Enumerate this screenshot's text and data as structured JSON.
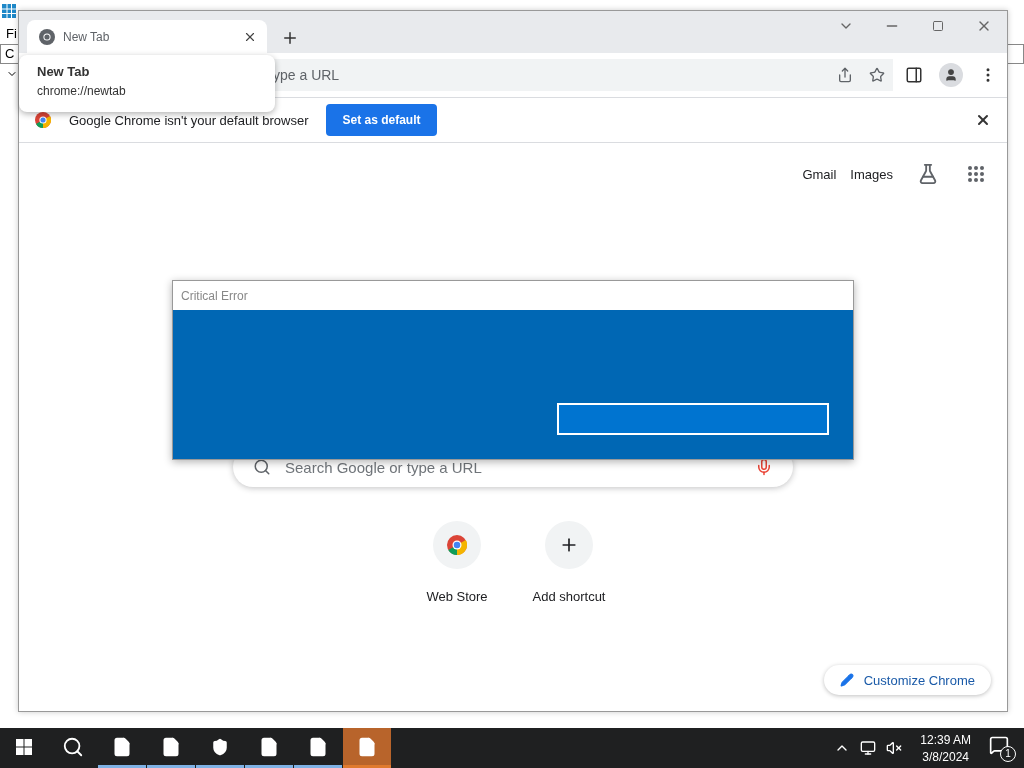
{
  "background_window": {
    "menu_fragment": "Fi",
    "field_fragment": "C"
  },
  "browser": {
    "tabs": [
      {
        "title": "New Tab",
        "selected": true
      }
    ],
    "tab_tooltip": {
      "title": "New Tab",
      "url": "chrome://newtab"
    },
    "omnibox": {
      "placeholder": "ype a URL"
    },
    "infobar": {
      "message": "Google Chrome isn't your default browser",
      "button": "Set as default"
    },
    "new_tab_page": {
      "links": [
        "Gmail",
        "Images"
      ],
      "search": {
        "placeholder": "Search Google or type a URL"
      },
      "shortcuts": [
        {
          "label": "Web Store",
          "kind": "store"
        },
        {
          "label": "Add shortcut",
          "kind": "add"
        }
      ],
      "customize_button": "Customize Chrome"
    }
  },
  "dialog": {
    "title": "Critical Error"
  },
  "taskbar": {
    "items": [
      {
        "kind": "start",
        "running": false,
        "selected": false
      },
      {
        "kind": "search",
        "running": false,
        "selected": false
      },
      {
        "kind": "file",
        "running": true,
        "selected": false
      },
      {
        "kind": "file",
        "running": true,
        "selected": false
      },
      {
        "kind": "shield",
        "running": true,
        "selected": false
      },
      {
        "kind": "file",
        "running": true,
        "selected": false
      },
      {
        "kind": "file",
        "running": true,
        "selected": false
      },
      {
        "kind": "file",
        "running": false,
        "selected": true
      }
    ],
    "clock": {
      "time": "12:39 AM",
      "date": "3/8/2024"
    },
    "notification_count": "1"
  }
}
